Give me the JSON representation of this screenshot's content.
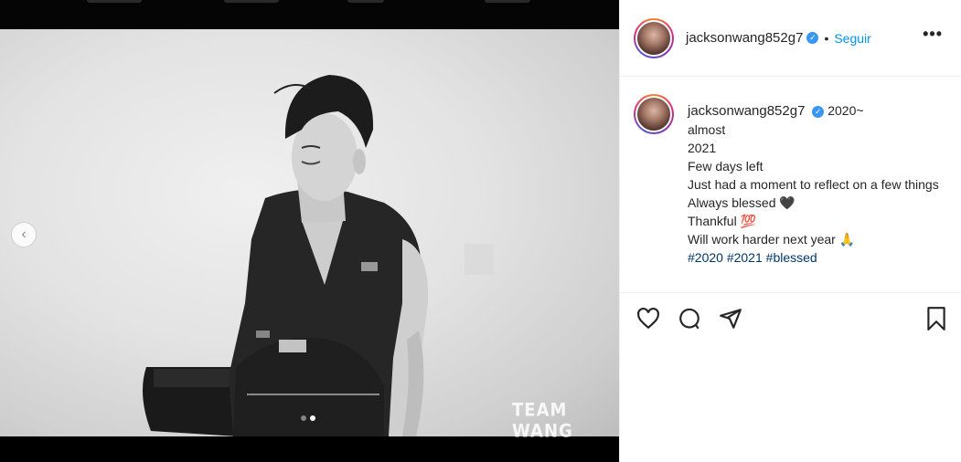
{
  "post": {
    "username": "jacksonwang852g7",
    "follow_label": "Seguir",
    "separator": "•",
    "more_label": "•••",
    "prev_label": "‹",
    "watermark": "TEAM WANG"
  },
  "caption": {
    "username": "jacksonwang852g7",
    "lines": [
      "2020~",
      "almost",
      "2021",
      "Few days left",
      "Just had a moment to reflect on a few things",
      "Always blessed 🖤",
      "Thankful 💯",
      "Will work harder next year 🙏"
    ],
    "hashtags": [
      "#2020",
      "#2021",
      "#blessed"
    ]
  },
  "colors": {
    "follow": "#0095f6",
    "verified": "#3897f0",
    "hashtag": "#00376b"
  },
  "icons": [
    "heart-icon",
    "comment-icon",
    "share-icon",
    "bookmark-icon",
    "verified-badge-icon",
    "chevron-left-icon",
    "more-icon"
  ]
}
